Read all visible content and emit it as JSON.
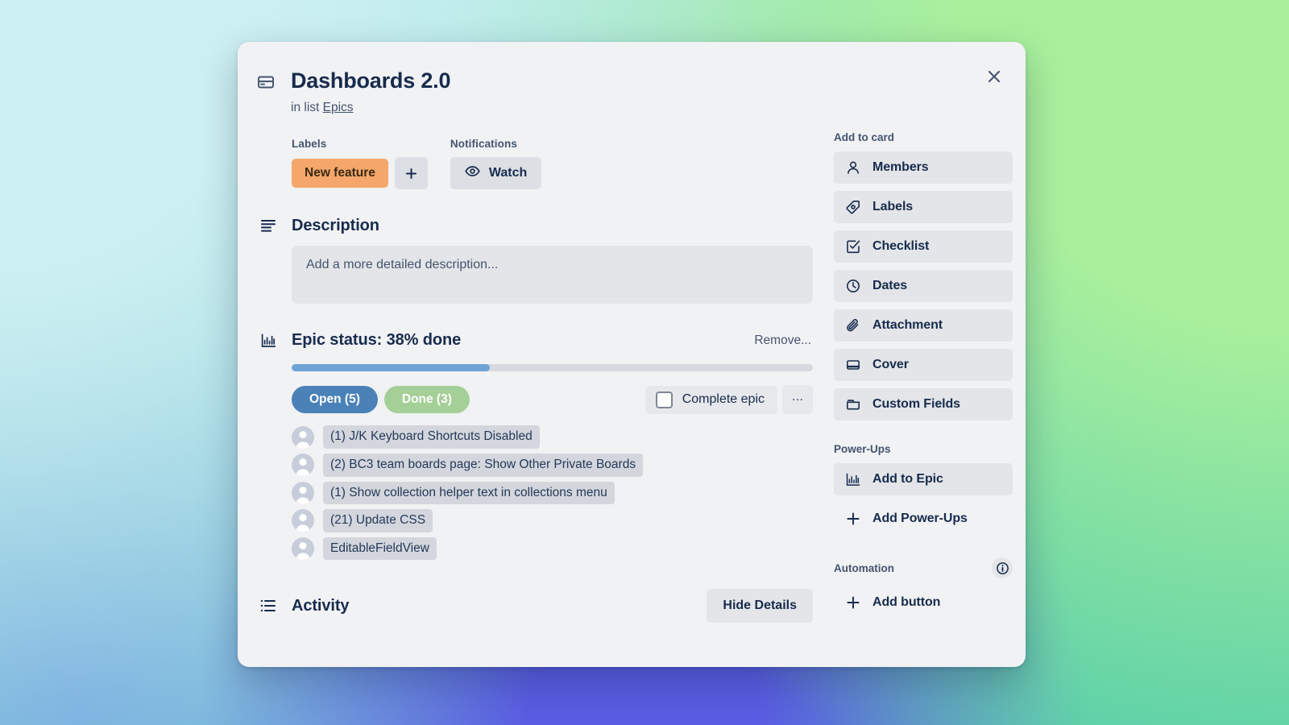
{
  "card": {
    "title": "Dashboards 2.0",
    "in_list_prefix": "in list",
    "list_name": "Epics",
    "close_label": "×"
  },
  "meta": {
    "labels_heading": "Labels",
    "label_chip": "New feature",
    "label_chip_color": "#f5a66a",
    "add_label_glyph": "+",
    "notifications_heading": "Notifications",
    "watch_label": "Watch"
  },
  "description": {
    "heading": "Description",
    "placeholder": "Add a more detailed description..."
  },
  "epic": {
    "heading": "Epic status: 38% done",
    "remove_label": "Remove...",
    "percent": 38,
    "open_label": "Open (5)",
    "done_label": "Done (3)",
    "open_color": "#4a82b8",
    "done_color": "#a4cf97",
    "progress_color": "#6fa3d6",
    "complete_epic_label": "Complete epic",
    "more_label": "...",
    "tasks": [
      "(1) J/K Keyboard Shortcuts Disabled",
      "(2) BC3 team boards page: Show Other Private Boards",
      "(1) Show collection helper text in collections menu",
      "(21) Update CSS",
      "EditableFieldView"
    ]
  },
  "activity": {
    "heading": "Activity",
    "hide_details_label": "Hide Details"
  },
  "sidebar": {
    "add_to_card_heading": "Add to card",
    "add_to_card_items": [
      {
        "label": "Members",
        "icon": "member-icon"
      },
      {
        "label": "Labels",
        "icon": "label-tag-icon"
      },
      {
        "label": "Checklist",
        "icon": "checklist-icon"
      },
      {
        "label": "Dates",
        "icon": "clock-icon"
      },
      {
        "label": "Attachment",
        "icon": "paperclip-icon"
      },
      {
        "label": "Cover",
        "icon": "cover-icon"
      },
      {
        "label": "Custom Fields",
        "icon": "custom-fields-icon"
      }
    ],
    "power_ups_heading": "Power-Ups",
    "power_ups_items": [
      {
        "label": "Add to Epic",
        "icon": "bar-chart-icon",
        "filled": true
      },
      {
        "label": "Add Power-Ups",
        "icon": "plus-icon",
        "filled": false
      }
    ],
    "automation_heading": "Automation",
    "automation_items": [
      {
        "label": "Add button",
        "icon": "plus-icon",
        "filled": false
      }
    ]
  }
}
